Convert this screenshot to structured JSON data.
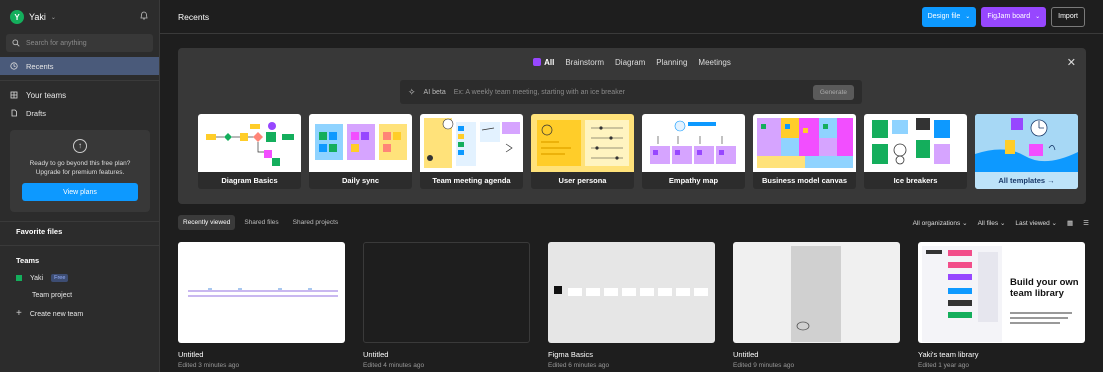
{
  "user": {
    "initial": "Y",
    "name": "Yaki"
  },
  "sidebar": {
    "search_placeholder": "Search for anything",
    "recents": "Recents",
    "your_teams": "Your teams",
    "drafts": "Drafts",
    "upsell": {
      "line1": "Ready to go beyond this free plan?",
      "line2": "Upgrade for premium features.",
      "button": "View plans"
    },
    "favorite_files": "Favorite files",
    "teams_title": "Teams",
    "team_name": "Yaki",
    "team_badge": "Free",
    "team_project": "Team project",
    "create_team": "Create new team"
  },
  "header": {
    "title": "Recents",
    "design_file": "Design file",
    "figjam_board": "FigJam board",
    "import": "Import"
  },
  "templates_panel": {
    "categories": [
      "All",
      "Brainstorm",
      "Diagram",
      "Planning",
      "Meetings"
    ],
    "ai_label": "AI beta",
    "ai_placeholder": "Ex: A weekly team meeting, starting with an ice breaker",
    "generate": "Generate",
    "templates": [
      "Diagram Basics",
      "Daily sync",
      "Team meeting agenda",
      "User persona",
      "Empathy map",
      "Business model canvas",
      "Ice breakers"
    ],
    "all_templates": "All templates →"
  },
  "filters": {
    "tabs": [
      "Recently viewed",
      "Shared files",
      "Shared projects"
    ],
    "organizations": "All organizations",
    "files": "All files",
    "sort": "Last viewed"
  },
  "files": [
    {
      "name": "Untitled",
      "meta": "Edited 3 minutes ago"
    },
    {
      "name": "Untitled",
      "meta": "Edited 4 minutes ago"
    },
    {
      "name": "Figma Basics",
      "meta": "Edited 6 minutes ago"
    },
    {
      "name": "Untitled",
      "meta": "Edited 9 minutes ago"
    },
    {
      "name": "Yaki's team library",
      "meta": "Edited 1 year ago"
    }
  ],
  "library_card": {
    "title_line1": "Build your own",
    "title_line2": "team library"
  },
  "colors": {
    "accent_blue": "#0d99ff",
    "figjam_purple": "#9747ff",
    "sidebar_active": "#4a5a7a",
    "team_green": "#14ae5c"
  }
}
